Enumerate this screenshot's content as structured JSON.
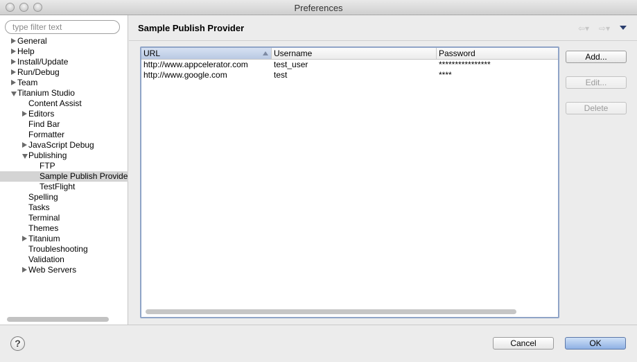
{
  "window": {
    "title": "Preferences"
  },
  "sidebar": {
    "filter_placeholder": "type filter text",
    "tree": [
      {
        "label": "General",
        "twisty": "collapsed",
        "level": 0
      },
      {
        "label": "Help",
        "twisty": "collapsed",
        "level": 0
      },
      {
        "label": "Install/Update",
        "twisty": "collapsed",
        "level": 0
      },
      {
        "label": "Run/Debug",
        "twisty": "collapsed",
        "level": 0
      },
      {
        "label": "Team",
        "twisty": "collapsed",
        "level": 0
      },
      {
        "label": "Titanium Studio",
        "twisty": "expanded",
        "level": 0
      },
      {
        "label": "Content Assist",
        "twisty": "none",
        "level": 1
      },
      {
        "label": "Editors",
        "twisty": "collapsed",
        "level": 1
      },
      {
        "label": "Find Bar",
        "twisty": "none",
        "level": 1
      },
      {
        "label": "Formatter",
        "twisty": "none",
        "level": 1
      },
      {
        "label": "JavaScript Debug",
        "twisty": "collapsed",
        "level": 1
      },
      {
        "label": "Publishing",
        "twisty": "expanded",
        "level": 1
      },
      {
        "label": "FTP",
        "twisty": "none",
        "level": 2
      },
      {
        "label": "Sample Publish Provider",
        "twisty": "none",
        "level": 2,
        "selected": true
      },
      {
        "label": "TestFlight",
        "twisty": "none",
        "level": 2
      },
      {
        "label": "Spelling",
        "twisty": "none",
        "level": 1
      },
      {
        "label": "Tasks",
        "twisty": "none",
        "level": 1
      },
      {
        "label": "Terminal",
        "twisty": "none",
        "level": 1
      },
      {
        "label": "Themes",
        "twisty": "none",
        "level": 1
      },
      {
        "label": "Titanium",
        "twisty": "collapsed",
        "level": 1
      },
      {
        "label": "Troubleshooting",
        "twisty": "none",
        "level": 1
      },
      {
        "label": "Validation",
        "twisty": "none",
        "level": 1
      },
      {
        "label": "Web Servers",
        "twisty": "collapsed",
        "level": 1
      }
    ]
  },
  "pane": {
    "title": "Sample Publish Provider",
    "nav": {
      "back_icon": "back-arrow-icon",
      "forward_icon": "forward-arrow-icon",
      "menu_icon": "view-menu-icon"
    }
  },
  "table": {
    "columns": [
      "URL",
      "Username",
      "Password"
    ],
    "rows": [
      {
        "url": "http://www.appcelerator.com",
        "username": "test_user",
        "password": "****************"
      },
      {
        "url": "http://www.google.com",
        "username": "test",
        "password": "****"
      }
    ]
  },
  "buttons": {
    "add": "Add...",
    "edit": "Edit...",
    "delete": "Delete",
    "cancel": "Cancel",
    "ok": "OK"
  },
  "help": {
    "glyph": "?"
  }
}
